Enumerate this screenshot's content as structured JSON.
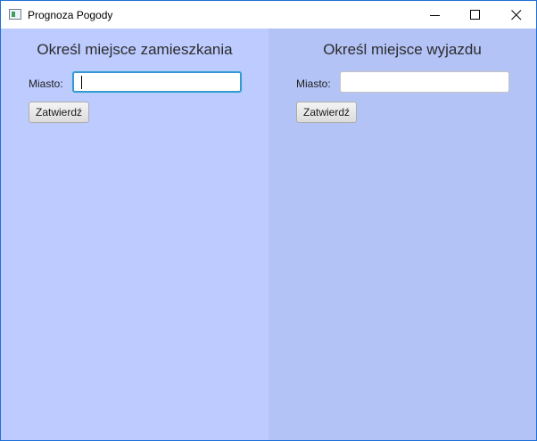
{
  "window": {
    "title": "Prognoza Pogody",
    "icon": "app-window-icon",
    "controls": {
      "minimize_icon": "minimize-icon",
      "maximize_icon": "maximize-icon",
      "close_icon": "close-icon"
    }
  },
  "home_panel": {
    "heading": "Określ miejsce zamieszkania",
    "city_label": "Miasto:",
    "city_value": "",
    "submit_label": "Zatwierdź",
    "background": "#bdcbff"
  },
  "departure_panel": {
    "heading": "Określ miejsce wyjazdu",
    "city_label": "Miasto:",
    "city_value": "",
    "submit_label": "Zatwierdź",
    "background": "#b4c3f6"
  },
  "colors": {
    "focus_ring": "#3a97d6",
    "window_border": "#1e6fd9"
  }
}
